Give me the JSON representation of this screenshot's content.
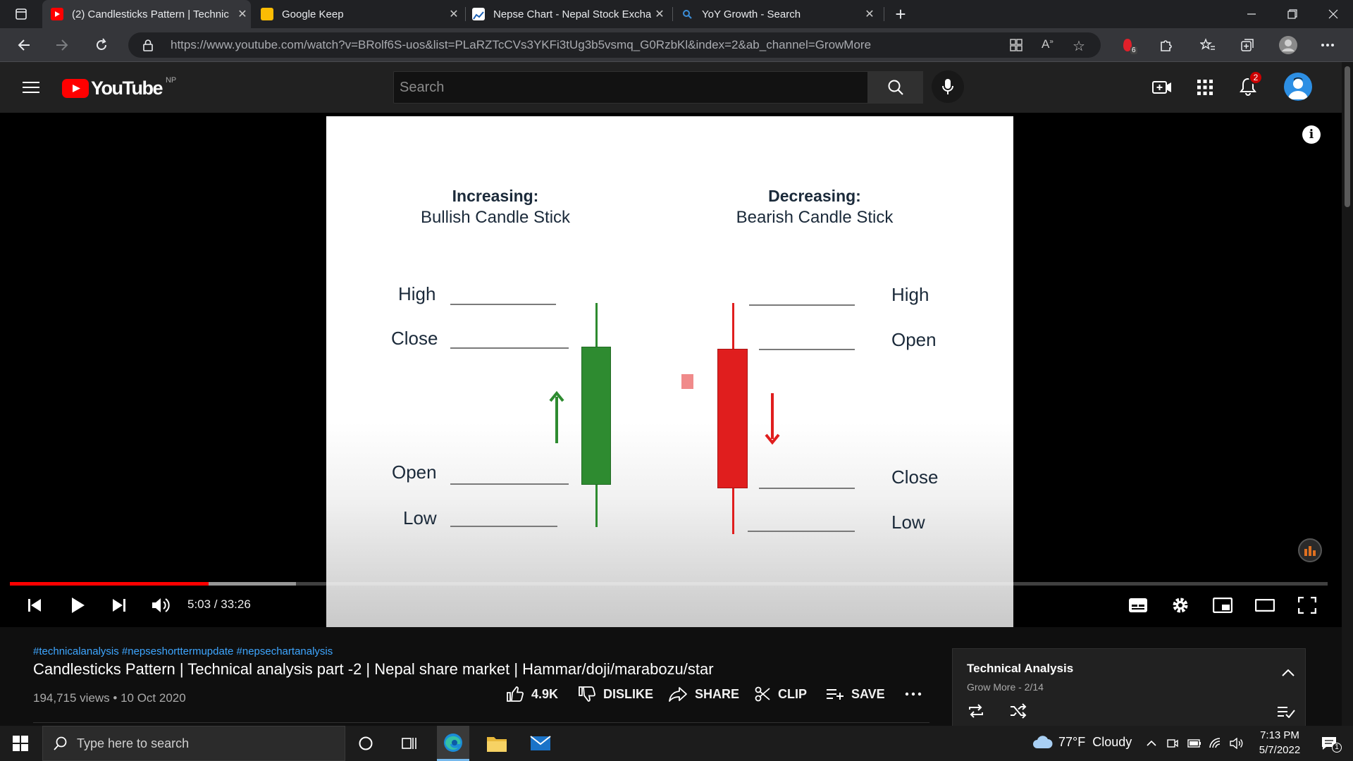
{
  "browser": {
    "tabs": [
      {
        "title": "(2) Candlesticks Pattern | Technic",
        "icon": "youtube-favicon",
        "color": "#ff0000",
        "active": true
      },
      {
        "title": "Google Keep",
        "icon": "keep-favicon",
        "color": "#fbbc04",
        "active": false
      },
      {
        "title": "Nepse Chart - Nepal Stock Excha",
        "icon": "nepse-favicon",
        "color": "#ffffff",
        "active": false
      },
      {
        "title": "YoY Growth - Search",
        "icon": "bing-search-favicon",
        "color": "#3b8ed8",
        "active": false
      }
    ],
    "url": "https://www.youtube.com/watch?v=BRolf6S-uos&list=PLaRZTcCVs3YKFi3tUg3b5vsmq_G0RzbKl&index=2&ab_channel=GrowMore",
    "extension_badge": "6"
  },
  "youtube": {
    "logo_text": "YouTube",
    "region": "NP",
    "search_placeholder": "Search",
    "notification_count": "2"
  },
  "slide": {
    "bullish_heading": "Increasing:",
    "bullish_sub": "Bullish Candle Stick",
    "bearish_heading": "Decreasing:",
    "bearish_sub": "Bearish Candle Stick",
    "bullish_labels": {
      "high": "High",
      "close": "Close",
      "open": "Open",
      "low": "Low"
    },
    "bearish_labels": {
      "high": "High",
      "open": "Open",
      "close": "Close",
      "low": "Low"
    },
    "bull_color": "#2e8b30",
    "bear_color": "#e01e1e"
  },
  "player": {
    "time": "5:03 / 33:26",
    "played_fraction": 0.151,
    "buffered_fraction": 0.217
  },
  "video": {
    "hashtags": "#technicalanalysis #nepseshorttermupdate #nepsechartanalysis",
    "title": "Candlesticks Pattern | Technical analysis part -2 | Nepal share market | Hammar/doji/marabozu/star",
    "meta": "194,715 views • 10 Oct 2020",
    "likes": "4.9K",
    "dislike_label": "DISLIKE",
    "share_label": "SHARE",
    "clip_label": "CLIP",
    "save_label": "SAVE"
  },
  "playlist": {
    "title": "Technical Analysis",
    "subtitle": "Grow More - 2/14"
  },
  "taskbar": {
    "search_placeholder": "Type here to search",
    "weather": "77°F  Cloudy",
    "time": "7:13 PM",
    "date": "5/7/2022",
    "notification_count": "1"
  }
}
